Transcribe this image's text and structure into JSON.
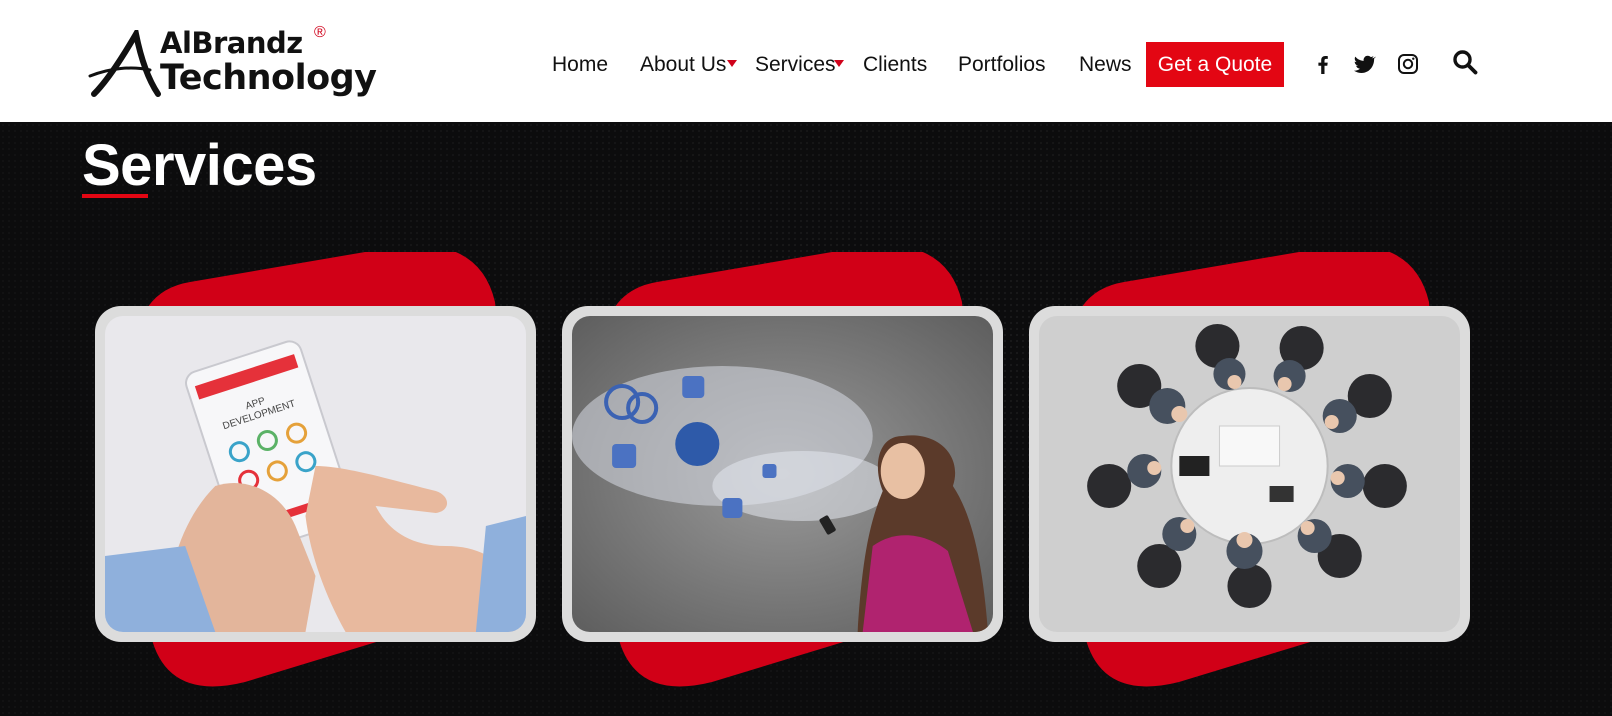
{
  "brand": {
    "line1": "AlBrandz",
    "line2": "Technology",
    "reg": "®"
  },
  "nav": {
    "items": [
      {
        "label": "Home",
        "has_dropdown": false
      },
      {
        "label": "About Us",
        "has_dropdown": true
      },
      {
        "label": "Services",
        "has_dropdown": true
      },
      {
        "label": "Clients",
        "has_dropdown": false
      },
      {
        "label": "Portfolios",
        "has_dropdown": false
      },
      {
        "label": "News",
        "has_dropdown": false
      }
    ],
    "cta": "Get a Quote",
    "social": [
      "facebook-icon",
      "twitter-icon",
      "instagram-icon"
    ],
    "search_icon": "search-icon"
  },
  "hero": {
    "title": "Services",
    "cards": [
      {
        "image": "app-development-phone-photo"
      },
      {
        "image": "social-media-woman-phone-photo"
      },
      {
        "image": "business-meeting-table-photo"
      }
    ]
  },
  "colors": {
    "accent": "#e30613",
    "background": "#0c0c0d",
    "header": "#ffffff"
  }
}
